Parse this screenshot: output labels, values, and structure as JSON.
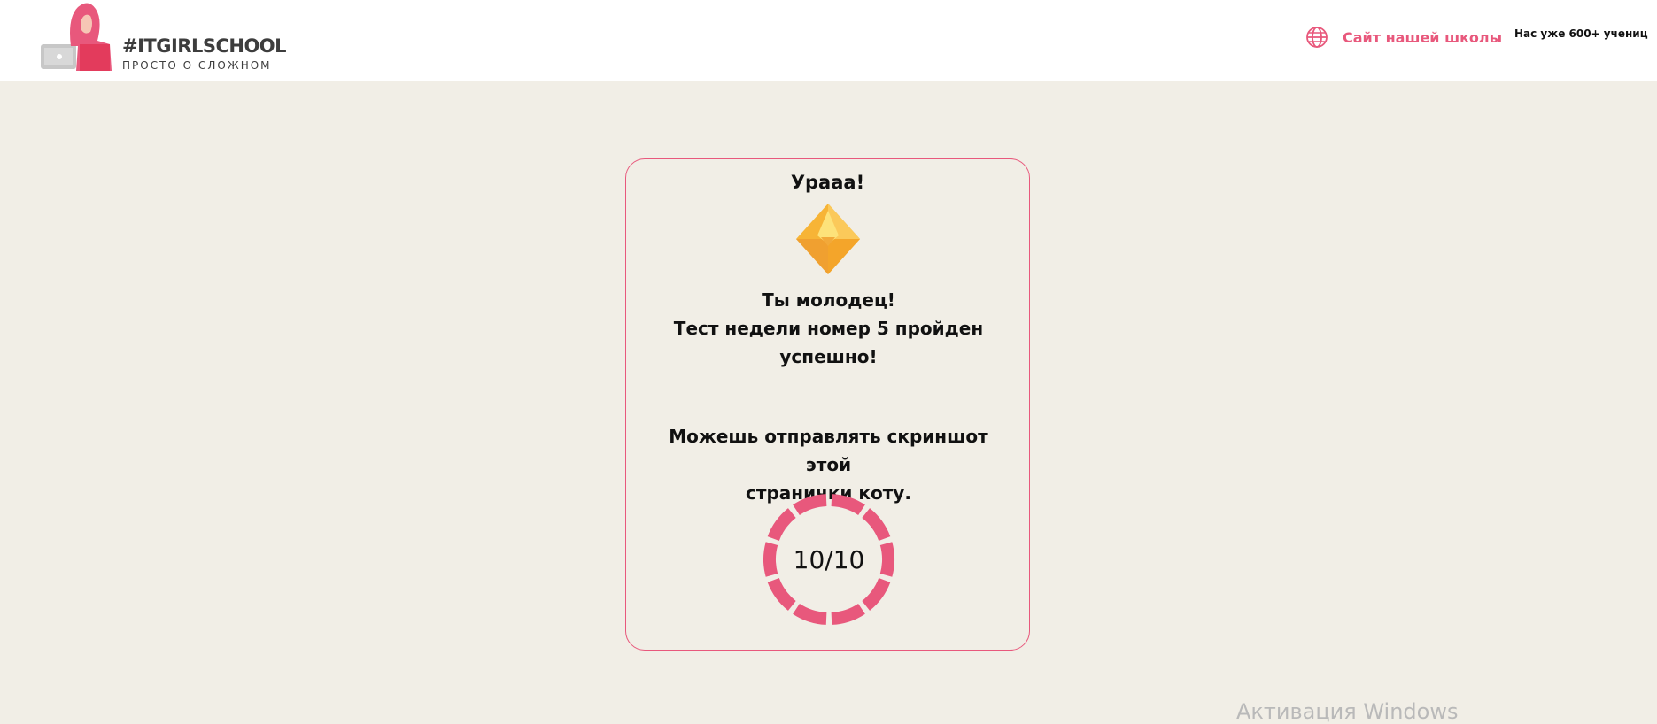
{
  "header": {
    "logo_title": "#ITGIRLSCHOOL",
    "logo_subtitle": "ПРОСТО О СЛОЖНОМ",
    "site_link_label": "Сайт нашей школы",
    "site_link_icon": "globe-icon",
    "students_text": "Нас уже 600+ учениц"
  },
  "result_card": {
    "title": "Урааа!",
    "badge_icon": "diamond-gem-icon",
    "message_lines": [
      "Ты молодец!",
      "Тест недели номер 5 пройден",
      "успешно!"
    ],
    "note_lines": [
      "Можешь отправлять скриншот этой",
      "странички коту."
    ],
    "score": {
      "text": "10/10",
      "correct": 10,
      "total": 10
    }
  },
  "os_watermark": "Активация Windows",
  "colors": {
    "accent": "#e8587c",
    "background": "#f1eee6",
    "header_bg": "#ffffff",
    "gem": "#f7b436"
  }
}
